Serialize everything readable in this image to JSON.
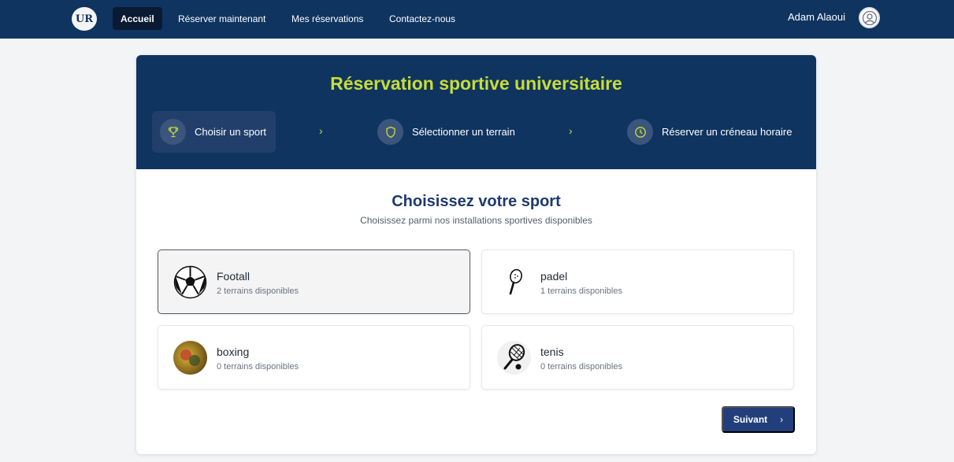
{
  "nav": {
    "logo_text": "UR",
    "links": [
      "Accueil",
      "Réserver maintenant",
      "Mes réservations",
      "Contactez-nous"
    ],
    "user_name": "Adam Alaoui"
  },
  "booking": {
    "title": "Réservation sportive universitaire",
    "steps": [
      "Choisir un sport",
      "Sélectionner un terrain",
      "Réserver un créneau horaire"
    ],
    "step_icons": [
      "trophy-icon",
      "shield-icon",
      "clock-icon"
    ],
    "separator": "›"
  },
  "sport_section": {
    "title": "Choisissez votre sport",
    "subtitle": "Choisissez parmi nos installations sportives disponibles",
    "sports": [
      {
        "name": "Footall",
        "availability": "2 terrains disponibles",
        "icon": "soccer-ball-icon",
        "selected": true
      },
      {
        "name": "padel",
        "availability": "1 terrains disponibles",
        "icon": "padel-racket-icon",
        "selected": false
      },
      {
        "name": "boxing",
        "availability": "0 terrains disponibles",
        "icon": "boxing-image-icon",
        "selected": false
      },
      {
        "name": "tenis",
        "availability": "0 terrains disponibles",
        "icon": "tennis-racket-icon",
        "selected": false
      }
    ]
  },
  "actions": {
    "next_label": "Suivant",
    "next_arrow": "›"
  },
  "colors": {
    "navbar": "#0f3460",
    "accent": "#c8dd36",
    "button": "#223f7c"
  }
}
